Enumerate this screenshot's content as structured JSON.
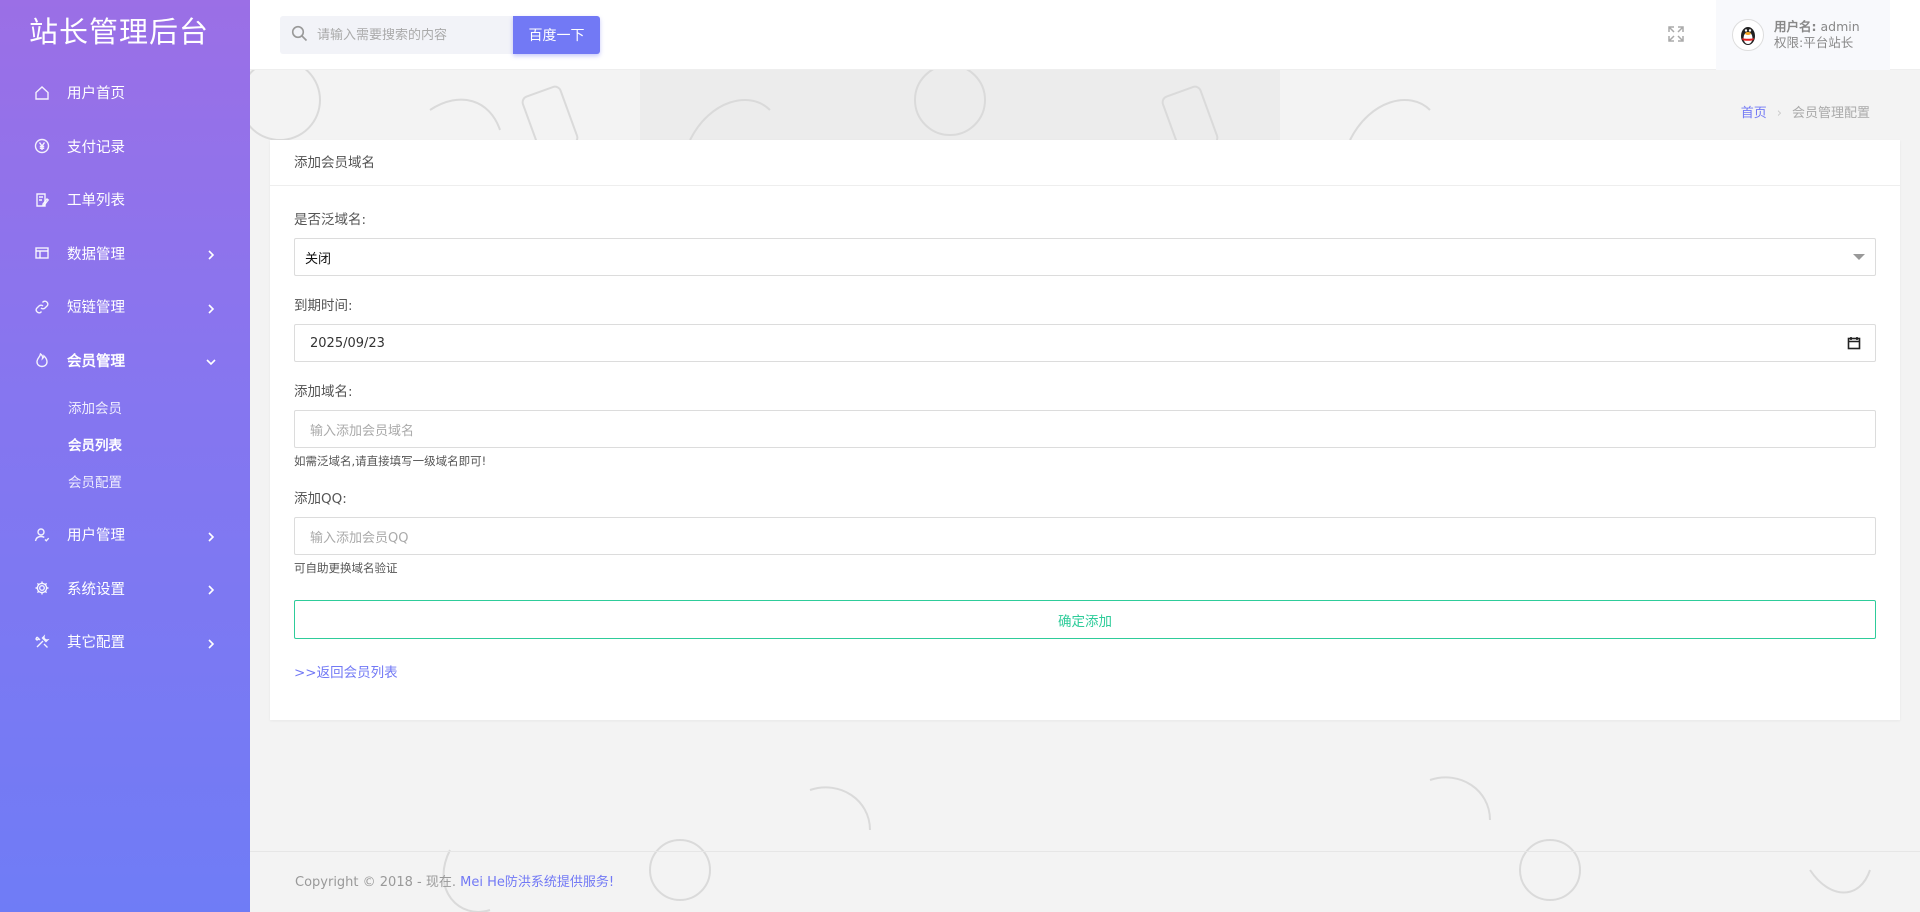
{
  "brand": "站长管理后台",
  "sidebar": {
    "items": [
      {
        "label": "用户首页",
        "icon": "home-icon"
      },
      {
        "label": "支付记录",
        "icon": "yen-icon"
      },
      {
        "label": "工单列表",
        "icon": "ticket-icon"
      },
      {
        "label": "数据管理",
        "icon": "database-icon"
      },
      {
        "label": "短链管理",
        "icon": "link-icon"
      },
      {
        "label": "会员管理",
        "icon": "fire-icon"
      },
      {
        "label": "用户管理",
        "icon": "user-icon"
      },
      {
        "label": "系统设置",
        "icon": "gear-icon"
      },
      {
        "label": "其它配置",
        "icon": "tools-icon"
      }
    ],
    "member_sub": [
      "添加会员",
      "会员列表",
      "会员配置"
    ]
  },
  "header": {
    "search_placeholder": "请输入需要搜索的内容",
    "search_button": "百度一下",
    "user_label": "用户名:",
    "user_name": "admin",
    "role_label": "权限:",
    "role_value": "平台站长"
  },
  "breadcrumb": {
    "home": "首页",
    "current": "会员管理配置"
  },
  "panel": {
    "title": "添加会员域名",
    "wildcard_label": "是否泛域名:",
    "wildcard_value": "关闭",
    "expire_label": "到期时间:",
    "expire_value": "2025/09/23",
    "domain_label": "添加域名:",
    "domain_placeholder": "输入添加会员域名",
    "domain_help": "如需泛域名,请直接填写一级域名即可!",
    "qq_label": "添加QQ:",
    "qq_placeholder": "输入添加会员QQ",
    "qq_help": "可自助更换域名验证",
    "submit": "确定添加",
    "back": ">>返回会员列表"
  },
  "footer": {
    "copyright": "Copyright © 2018 - 现在.",
    "provider": "Mei He防洪系统提供服务!"
  },
  "colors": {
    "accent": "#7279f5",
    "success": "#2ecc9a",
    "sidebar_top": "#9b6fe6",
    "sidebar_bottom": "#6f7cf6"
  }
}
